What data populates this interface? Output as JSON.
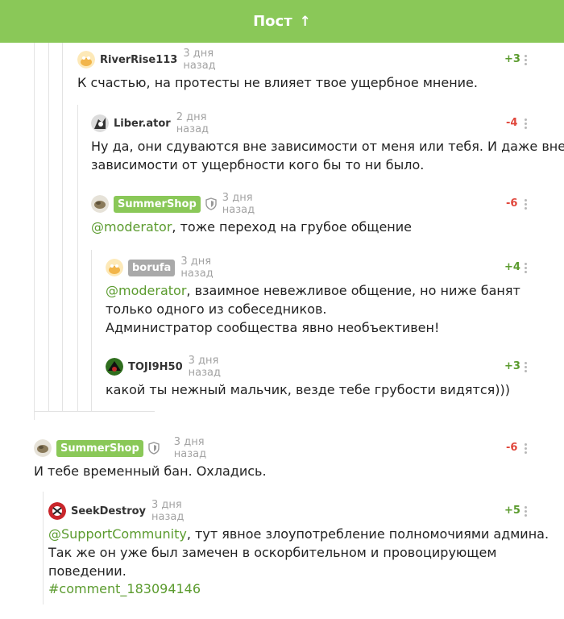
{
  "header": {
    "title": "Пост",
    "arrow": "↑"
  },
  "comments": [
    {
      "author": "RiverRise113",
      "time": "3 дня назад",
      "rating": "+3",
      "text": "К счастью, на протесты не влияет твое ущербное мнение."
    },
    {
      "author": "Liber.ator",
      "time": "2 дня назад",
      "rating": "-4",
      "line1": "Ну да, они сдуваются вне зависимости от меня или тебя. И даже вне",
      "line2": "зависимости от ущербности кого бы то ни было."
    },
    {
      "author": "SummerShop",
      "time": "3 дня назад",
      "rating": "-6",
      "mention": "@moderator",
      "text": ", тоже переход на грубое общение"
    },
    {
      "author": "borufa",
      "time": "3 дня назад",
      "rating": "+4",
      "mention": "@moderator",
      "line1": ", взаимное невежливое общение, но ниже банят",
      "line2": "только одного из собеседников.",
      "line3": "Администратор сообщества явно необъективен!"
    },
    {
      "author": "TOJI9H50",
      "time": "3 дня назад",
      "rating": "+3",
      "text": "какой ты нежный мальчик, везде тебе грубости видятся)))"
    },
    {
      "author": "SummerShop",
      "time": "3 дня назад",
      "rating": "-6",
      "text": "И тебе временный бан. Охладись."
    },
    {
      "author": "SeekDestroy",
      "time": "3 дня назад",
      "rating": "+5",
      "mention": "@SupportCommunity",
      "line1": ", тут явное злоупотребление полномочиями админа.",
      "line2": "Так же он уже был замечен в оскорбительном и провоцирующем",
      "line3": "поведении.",
      "hashtag": "#comment_183094146"
    }
  ],
  "colors": {
    "accent": "#8ac858",
    "positive": "#5b9b2e",
    "negative": "#e0463b",
    "muted": "#a3a3a3"
  },
  "icons": [
    "arrow-up-icon",
    "shield-icon",
    "more-vertical-icon",
    "avatar"
  ]
}
